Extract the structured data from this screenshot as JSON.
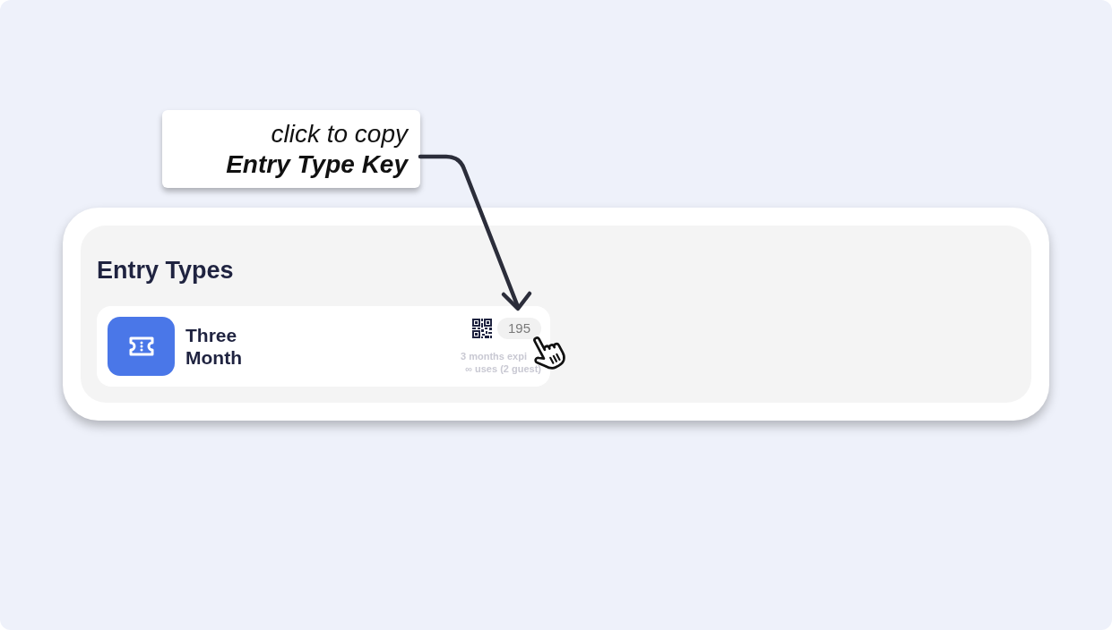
{
  "callout": {
    "hint": "click to copy",
    "label": "Entry Type Key"
  },
  "section": {
    "title": "Entry Types",
    "entries": [
      {
        "name": "Three Month",
        "key": "195",
        "expiry": "3 months expi",
        "uses": "∞ uses (2 guest)"
      }
    ]
  }
}
